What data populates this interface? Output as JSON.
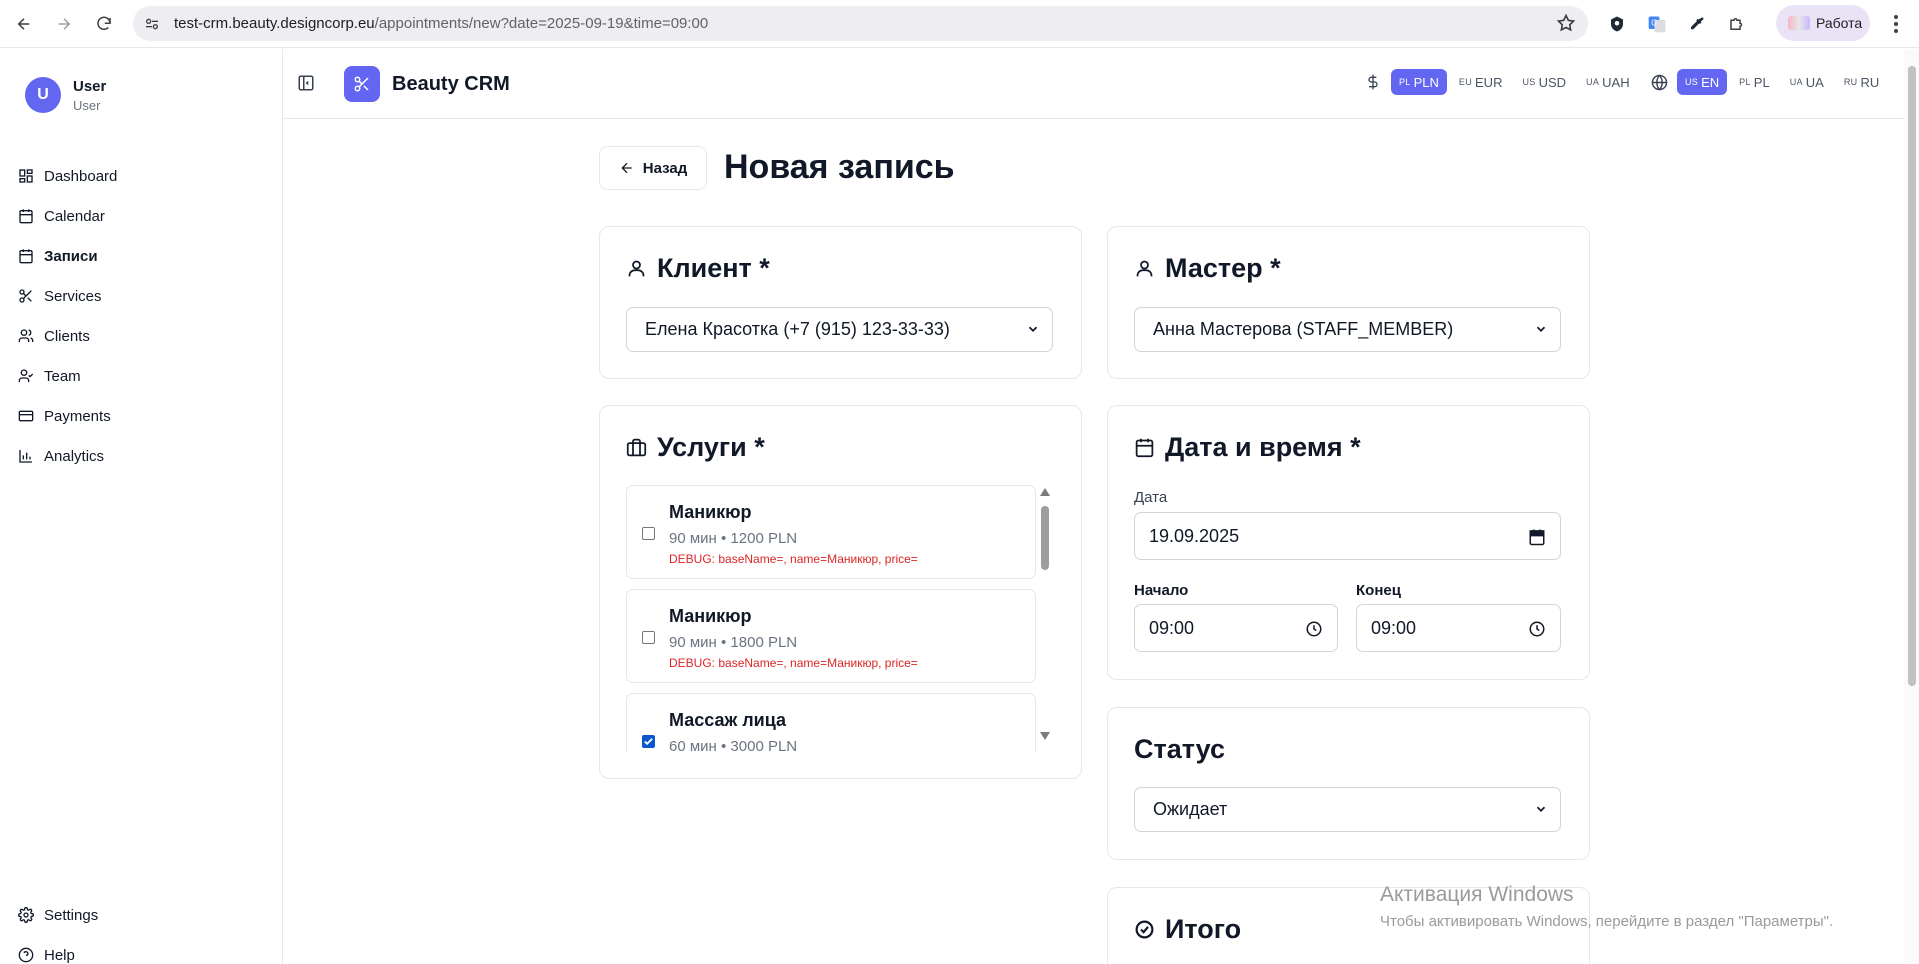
{
  "browser": {
    "url_host": "test-crm.beauty.designcorp.eu",
    "url_path": "/appointments/new?date=2025-09-19&time=09:00",
    "profile_label": "Работа"
  },
  "sidebar": {
    "user_initial": "U",
    "user_name": "User",
    "user_role": "User",
    "items": [
      {
        "label": "Dashboard",
        "icon": "dashboard-icon"
      },
      {
        "label": "Calendar",
        "icon": "calendar-icon"
      },
      {
        "label": "Записи",
        "icon": "calendar-days-icon",
        "active": true
      },
      {
        "label": "Services",
        "icon": "scissors-icon"
      },
      {
        "label": "Clients",
        "icon": "users-icon"
      },
      {
        "label": "Team",
        "icon": "user-check-icon"
      },
      {
        "label": "Payments",
        "icon": "credit-card-icon"
      },
      {
        "label": "Analytics",
        "icon": "bar-chart-icon"
      }
    ],
    "bottom_items": [
      {
        "label": "Settings",
        "icon": "gear-icon"
      },
      {
        "label": "Help",
        "icon": "help-icon"
      }
    ]
  },
  "topbar": {
    "brand": "Beauty CRM",
    "currencies": [
      {
        "code": "PL",
        "label": "PLN",
        "active": true
      },
      {
        "code": "EU",
        "label": "EUR",
        "active": false
      },
      {
        "code": "US",
        "label": "USD",
        "active": false
      },
      {
        "code": "UA",
        "label": "UAH",
        "active": false
      }
    ],
    "languages": [
      {
        "code": "US",
        "label": "EN",
        "active": true
      },
      {
        "code": "PL",
        "label": "PL",
        "active": false
      },
      {
        "code": "UA",
        "label": "UA",
        "active": false
      },
      {
        "code": "RU",
        "label": "RU",
        "active": false
      }
    ]
  },
  "page": {
    "back_label": "Назад",
    "title": "Новая запись"
  },
  "client_card": {
    "title": "Клиент *",
    "selected": "Елена Красотка (+7 (915) 123-33-33)"
  },
  "master_card": {
    "title": "Мастер *",
    "selected": "Анна Мастерова (STAFF_MEMBER)"
  },
  "services_card": {
    "title": "Услуги *",
    "items": [
      {
        "name": "Маникюр",
        "meta": "90 мин • 1200 PLN",
        "debug": "DEBUG: baseName=, name=Маникюр, price=",
        "checked": false
      },
      {
        "name": "Маникюр",
        "meta": "90 мин • 1800 PLN",
        "debug": "DEBUG: baseName=, name=Маникюр, price=",
        "checked": false
      },
      {
        "name": "Массаж лица",
        "meta": "60 мин • 3000 PLN",
        "debug": "",
        "checked": true
      }
    ]
  },
  "datetime_card": {
    "title": "Дата и время *",
    "date_label": "Дата",
    "date_value": "19.09.2025",
    "start_label": "Начало",
    "start_value": "09:00",
    "end_label": "Конец",
    "end_value": "09:00"
  },
  "status_card": {
    "title": "Статус",
    "selected": "Ожидает"
  },
  "total_card": {
    "title": "Итого"
  },
  "watermark": {
    "line1": "Активация Windows",
    "line2": "Чтобы активировать Windows, перейдите в раздел \"Параметры\"."
  },
  "colors": {
    "accent": "#6366f1",
    "debug_text": "#dc2626",
    "checkbox_checked": "#0b57d0"
  }
}
